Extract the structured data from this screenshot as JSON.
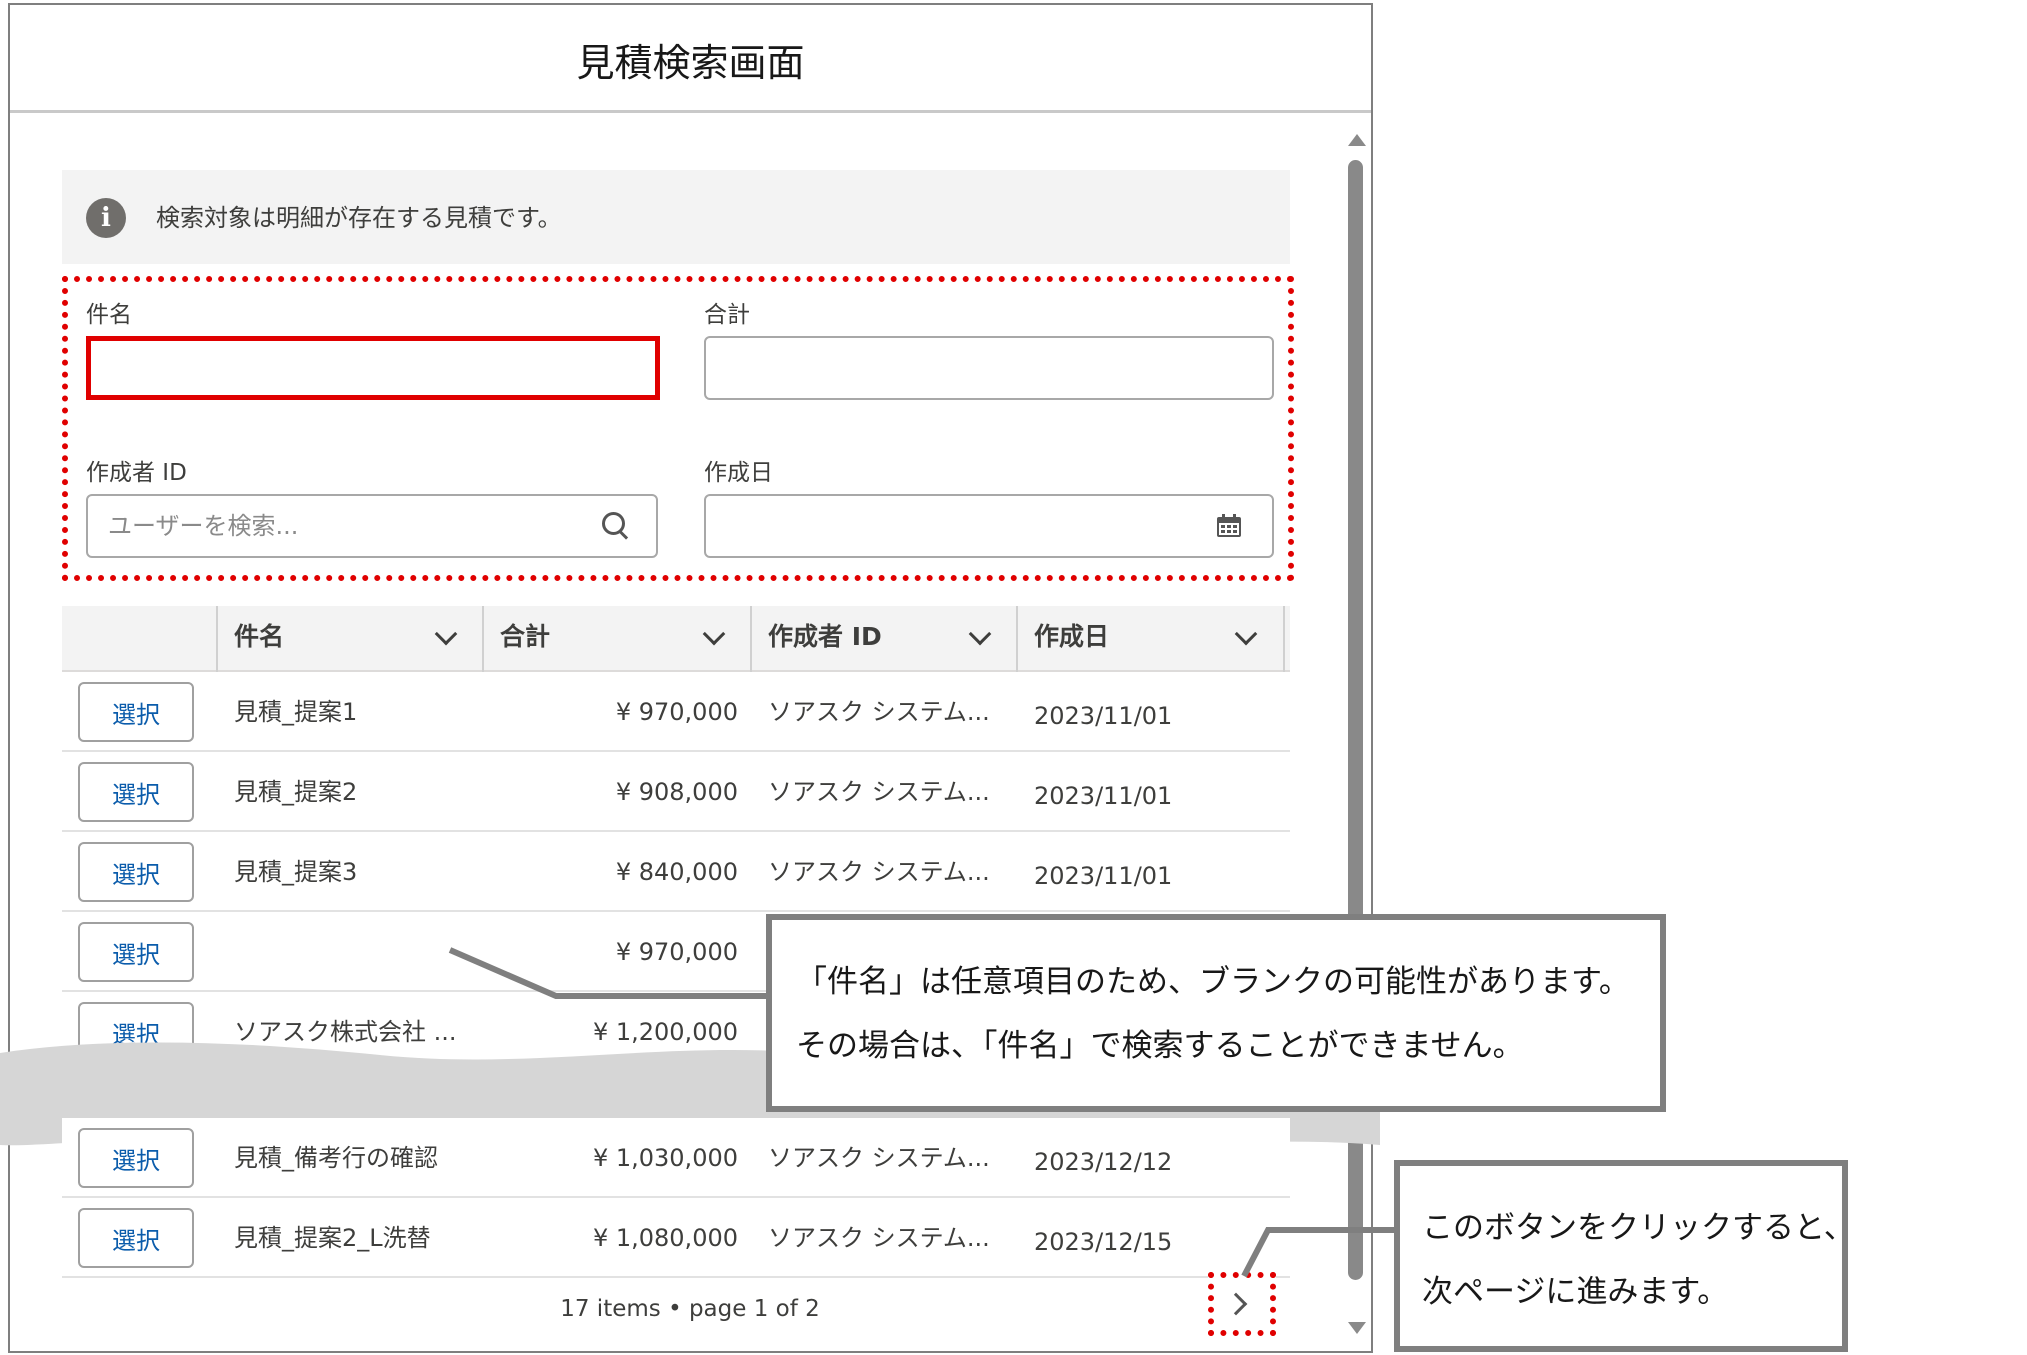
{
  "modal": {
    "title": "見積検索画面"
  },
  "info": {
    "text": "検索対象は明細が存在する見積です。"
  },
  "search": {
    "subject_label": "件名",
    "total_label": "合計",
    "creator_label": "作成者 ID",
    "creator_placeholder": "ユーザーを検索...",
    "created_date_label": "作成日"
  },
  "table": {
    "headers": [
      "件名",
      "合計",
      "作成者 ID",
      "作成日"
    ],
    "select_label": "選択",
    "rows": [
      {
        "subject": "見積_提案1",
        "total": "¥ 970,000",
        "creator": "ソアスク システム...",
        "date": "2023/11/01"
      },
      {
        "subject": "見積_提案2",
        "total": "¥ 908,000",
        "creator": "ソアスク システム...",
        "date": "2023/11/01"
      },
      {
        "subject": "見積_提案3",
        "total": "¥ 840,000",
        "creator": "ソアスク システム...",
        "date": "2023/11/01"
      },
      {
        "subject": "",
        "total": "¥ 970,000",
        "creator": "",
        "date": ""
      },
      {
        "subject": "ソアスク株式会社 ...",
        "total": "¥ 1,200,000",
        "creator": "",
        "date": ""
      },
      {
        "subject": "見積_備考行の確認",
        "total": "¥ 1,030,000",
        "creator": "ソアスク システム...",
        "date": "2023/12/12"
      },
      {
        "subject": "見積_提案2_L洗替",
        "total": "¥ 1,080,000",
        "creator": "ソアスク システム...",
        "date": "2023/12/15"
      }
    ]
  },
  "footer": {
    "pager_text": "17 items • page 1 of 2"
  },
  "callouts": {
    "subject_note_line1": "「件名」は任意項目のため、ブランクの可能性があります。",
    "subject_note_line2": "その場合は、「件名」で検索することができません。",
    "next_note_line1": "このボタンをクリックすると、",
    "next_note_line2": "次ページに進みます。"
  },
  "colors": {
    "highlight_red": "#e00000",
    "link_blue": "#0b5cab",
    "callout_border": "#7f7f7f",
    "header_bg": "#f3f3f3"
  }
}
